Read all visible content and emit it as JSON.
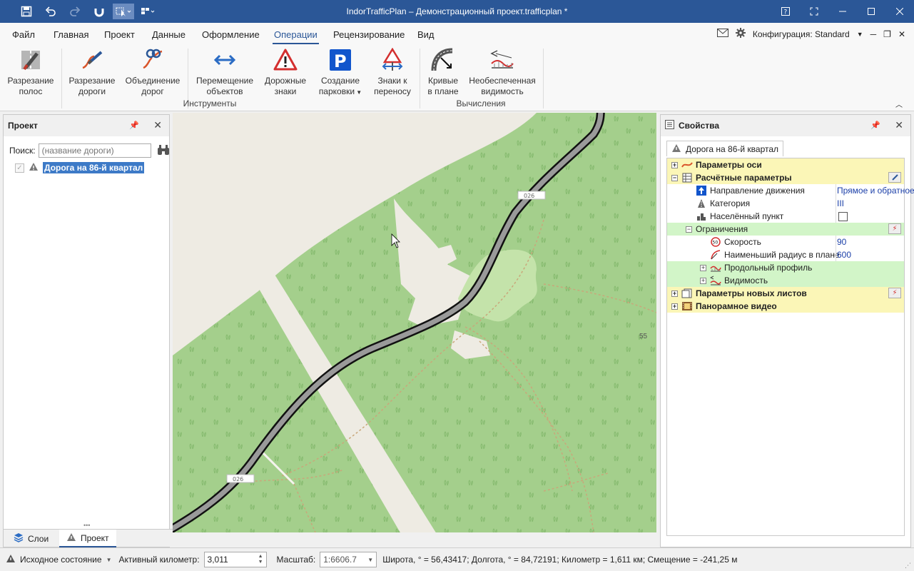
{
  "window": {
    "title": "IndorTrafficPlan – Демонстрационный проект.trafficplan *"
  },
  "quick_access": [
    "save-icon",
    "undo-icon",
    "redo-icon",
    "magnet-icon",
    "select-icon",
    "grid-icon"
  ],
  "tabs": [
    "Файл",
    "Главная",
    "Проект",
    "Данные",
    "Оформление",
    "Операции",
    "Рецензирование",
    "Вид"
  ],
  "active_tab": "Операции",
  "config": {
    "label": "Конфигурация: Standard"
  },
  "ribbon": {
    "buttons": [
      {
        "l1": "Разрезание",
        "l2": "полос"
      },
      {
        "l1": "Разрезание",
        "l2": "дороги"
      },
      {
        "l1": "Объединение",
        "l2": "дорог"
      },
      {
        "l1": "Перемещение",
        "l2": "объектов"
      },
      {
        "l1": "Дорожные",
        "l2": "знаки"
      },
      {
        "l1": "Создание",
        "l2": "парковки"
      },
      {
        "l1": "Знаки к",
        "l2": "переносу"
      },
      {
        "l1": "Кривые",
        "l2": "в плане"
      },
      {
        "l1": "Необеспеченная",
        "l2": "видимость"
      }
    ],
    "groups": {
      "tools": "Инструменты",
      "calc": "Вычисления"
    }
  },
  "project_panel": {
    "title": "Проект",
    "search_label": "Поиск:",
    "search_placeholder": "(название дороги)",
    "road": "Дорога на 86-й квартал",
    "tabs": {
      "layers": "Слои",
      "project": "Проект"
    }
  },
  "map": {
    "label_55": "55"
  },
  "properties": {
    "title": "Свойства",
    "object_tab": "Дорога на 86-й квартал",
    "rows": [
      {
        "name": "Параметры оси",
        "value": ""
      },
      {
        "name": "Расчётные параметры",
        "value": ""
      },
      {
        "name": "Направление движения",
        "value": "Прямое и обратное"
      },
      {
        "name": "Категория",
        "value": "III"
      },
      {
        "name": "Населённый пункт",
        "value": ""
      },
      {
        "name": "Ограничения",
        "value": ""
      },
      {
        "name": "Скорость",
        "value": "90"
      },
      {
        "name": "Наименьший радиус в плане",
        "value": "600"
      },
      {
        "name": "Продольный профиль",
        "value": ""
      },
      {
        "name": "Видимость",
        "value": ""
      },
      {
        "name": "Параметры новых листов",
        "value": ""
      },
      {
        "name": "Панорамное видео",
        "value": ""
      }
    ]
  },
  "status": {
    "state": "Исходное состояние",
    "km_label": "Активный километр:",
    "km_value": "3,011",
    "scale_label": "Масштаб:",
    "scale_value": "1:6606.7",
    "coords": "Широта, ° = 56,43417; Долгота, ° = 84,72191; Километр = 1,611 км; Смещение = -241,25 м"
  },
  "colors": {
    "accent": "#2b5797",
    "forest": "#a4cf8c",
    "clearing": "#eeebe3",
    "category": "#fbf6b7",
    "subcategory": "#d2f5c8"
  }
}
